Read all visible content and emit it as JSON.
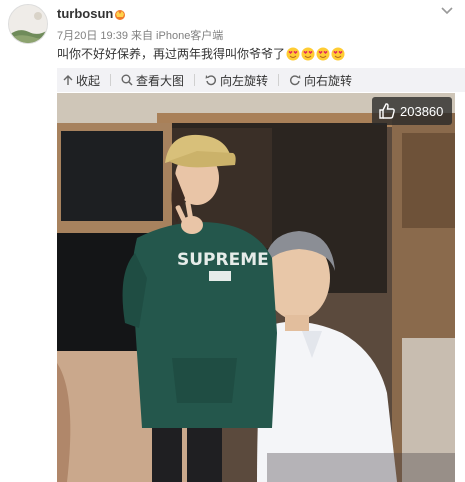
{
  "post": {
    "username": "turbosun",
    "timestamp": "7月20日 19:39",
    "source": "来自 iPhone客户端",
    "text": "叫你不好好保养，再过两年我得叫你爷爷了",
    "emoji_count": 4
  },
  "toolbar": {
    "collapse_label": "收起",
    "view_full_label": "查看大图",
    "rotate_left_label": "向左旋转",
    "rotate_right_label": "向右旋转"
  },
  "photo": {
    "like_count": "203860",
    "shirt_text": "SUPREME"
  },
  "icons": {
    "crown": "crown-icon",
    "dropdown": "chevron-down-icon",
    "like": "thumbs-up-icon",
    "collapse": "arrow-up-icon",
    "zoom": "magnifier-icon",
    "rotate_left": "rotate-left-icon",
    "rotate_right": "rotate-right-icon"
  },
  "colors": {
    "accent_link": "#333333",
    "meta_gray": "#808080",
    "toolbar_bg": "#f2f2f5",
    "badge_bg": "#282828"
  }
}
